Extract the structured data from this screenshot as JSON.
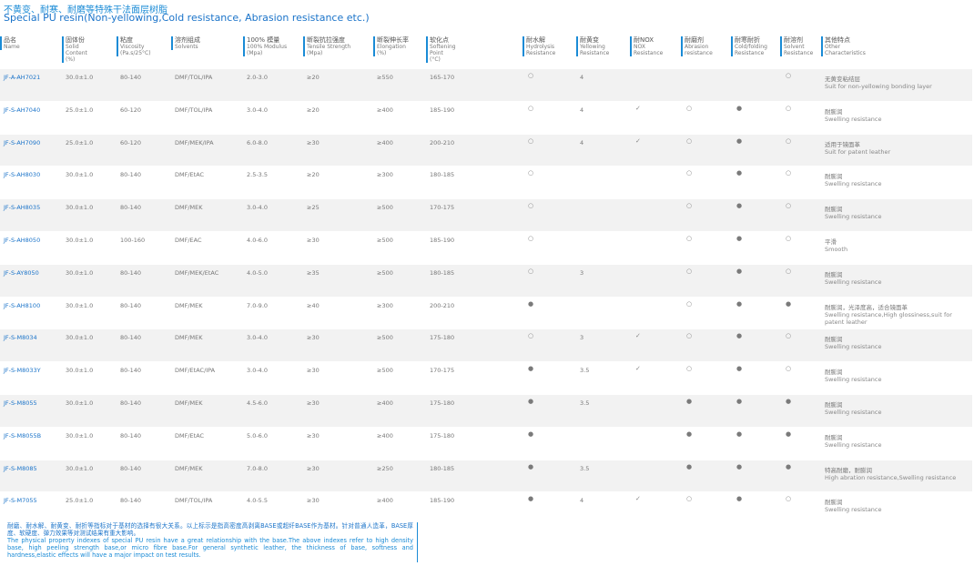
{
  "title": {
    "cn": "不黄变、耐寒、耐磨等特殊干法面层树脂",
    "en": "Special PU resin(Non-yellowing,Cold resistance, Abrasion resistance etc.)"
  },
  "headers": [
    {
      "cn": "品名",
      "en": [
        "Name"
      ]
    },
    {
      "cn": "固体份",
      "en": [
        "Solid",
        "Content",
        "(%)"
      ]
    },
    {
      "cn": "粘度",
      "en": [
        "Viscosity",
        "(Pa.s/25°C)"
      ]
    },
    {
      "cn": "溶剂组成",
      "en": [
        "Solvents"
      ]
    },
    {
      "cn": "100% 模量",
      "en": [
        "100% Modulus",
        "(Mpa)"
      ]
    },
    {
      "cn": "断裂抗拉强度",
      "en": [
        "Tensile Strength",
        "(Mpa)"
      ]
    },
    {
      "cn": "断裂伸长率",
      "en": [
        "Elongation",
        "(%)"
      ]
    },
    {
      "cn": "软化点",
      "en": [
        "Softening",
        "Point",
        "(°C)"
      ]
    },
    {
      "cn": "耐水解",
      "en": [
        "Hydrolysis",
        "Resistance"
      ]
    },
    {
      "cn": "耐黄变",
      "en": [
        "Yellowing",
        "Resistance"
      ]
    },
    {
      "cn": "耐NOX",
      "en": [
        "NOX",
        "Resistance"
      ]
    },
    {
      "cn": "耐磨剂",
      "en": [
        "Abrasion",
        "resistance"
      ]
    },
    {
      "cn": "耐寒耐折",
      "en": [
        "Cold/folding",
        "Resistance"
      ]
    },
    {
      "cn": "耐溶剂",
      "en": [
        "Solvent",
        "Resistance"
      ]
    },
    {
      "cn": "其他特点",
      "en": [
        "Other",
        "Characteristics"
      ]
    }
  ],
  "symbols": {
    "open": "○",
    "filled": "●",
    "check": "✓"
  },
  "rows": [
    {
      "name": "JF-A-AH7021",
      "solid": "30.0±1.0",
      "visc": "80-140",
      "solv": "DMF/TOL/IPA",
      "mod": "2.0-3.0",
      "ts": "≥20",
      "el": "≥550",
      "sp": "165-170",
      "hyd": "open",
      "yel": "4",
      "nox": "",
      "abr": "",
      "cold": "",
      "solvr": "open",
      "other_cn": "无黄变粘结层",
      "other_en": "Suit for non-yellowing bonding layer"
    },
    {
      "name": "JF-S-AH7040",
      "solid": "25.0±1.0",
      "visc": "60-120",
      "solv": "DMF/TOL/IPA",
      "mod": "3.0-4.0",
      "ts": "≥20",
      "el": "≥400",
      "sp": "185-190",
      "hyd": "open",
      "yel": "4",
      "nox": "check",
      "abr": "open",
      "cold": "filled",
      "solvr": "open",
      "other_cn": "耐膨润",
      "other_en": "Swelling resistance"
    },
    {
      "name": "JF-S-AH7090",
      "solid": "25.0±1.0",
      "visc": "60-120",
      "solv": "DMF/MEK/IPA",
      "mod": "6.0-8.0",
      "ts": "≥30",
      "el": "≥400",
      "sp": "200-210",
      "hyd": "open",
      "yel": "4",
      "nox": "check",
      "abr": "open",
      "cold": "filled",
      "solvr": "open",
      "other_cn": "适用于镜面革",
      "other_en": "Suit for patent leather"
    },
    {
      "name": "JF-S-AH8030",
      "solid": "30.0±1.0",
      "visc": "80-140",
      "solv": "DMF/EtAC",
      "mod": "2.5-3.5",
      "ts": "≥20",
      "el": "≥300",
      "sp": "180-185",
      "hyd": "open",
      "yel": "",
      "nox": "",
      "abr": "open",
      "cold": "filled",
      "solvr": "open",
      "other_cn": "耐膨润",
      "other_en": "Swelling resistance"
    },
    {
      "name": "JF-S-AH8035",
      "solid": "30.0±1.0",
      "visc": "80-140",
      "solv": "DMF/MEK",
      "mod": "3.0-4.0",
      "ts": "≥25",
      "el": "≥500",
      "sp": "170-175",
      "hyd": "open",
      "yel": "",
      "nox": "",
      "abr": "open",
      "cold": "filled",
      "solvr": "open",
      "other_cn": "耐膨润",
      "other_en": "Swelling resistance"
    },
    {
      "name": "JF-S-AH8050",
      "solid": "30.0±1.0",
      "visc": "100-160",
      "solv": "DMF/EAC",
      "mod": "4.0-6.0",
      "ts": "≥30",
      "el": "≥500",
      "sp": "185-190",
      "hyd": "open",
      "yel": "",
      "nox": "",
      "abr": "open",
      "cold": "filled",
      "solvr": "open",
      "other_cn": "平滑",
      "other_en": "Smooth"
    },
    {
      "name": "JF-S-AY8050",
      "solid": "30.0±1.0",
      "visc": "80-140",
      "solv": "DMF/MEK/EtAC",
      "mod": "4.0-5.0",
      "ts": "≥35",
      "el": "≥500",
      "sp": "180-185",
      "hyd": "open",
      "yel": "3",
      "nox": "",
      "abr": "open",
      "cold": "filled",
      "solvr": "open",
      "other_cn": "耐膨润",
      "other_en": "Swelling resistance"
    },
    {
      "name": "JF-S-AH8100",
      "solid": "30.0±1.0",
      "visc": "80-140",
      "solv": "DMF/MEK",
      "mod": "7.0-9.0",
      "ts": "≥40",
      "el": "≥300",
      "sp": "200-210",
      "hyd": "filled",
      "yel": "",
      "nox": "",
      "abr": "open",
      "cold": "filled",
      "solvr": "filled",
      "other_cn": "耐膨润，光泽度高，适合镜面革",
      "other_en": "Swelling resistance,High glossiness,suit for patent leather"
    },
    {
      "name": "JF-S-M8034",
      "solid": "30.0±1.0",
      "visc": "80-140",
      "solv": "DMF/MEK",
      "mod": "3.0-4.0",
      "ts": "≥30",
      "el": "≥500",
      "sp": "175-180",
      "hyd": "open",
      "yel": "3",
      "nox": "check",
      "abr": "open",
      "cold": "filled",
      "solvr": "open",
      "other_cn": "耐膨润",
      "other_en": "Swelling resistance"
    },
    {
      "name": "JF-S-M8033Y",
      "solid": "30.0±1.0",
      "visc": "80-140",
      "solv": "DMF/EtAC/IPA",
      "mod": "3.0-4.0",
      "ts": "≥30",
      "el": "≥500",
      "sp": "170-175",
      "hyd": "filled",
      "yel": "3.5",
      "nox": "check",
      "abr": "open",
      "cold": "filled",
      "solvr": "open",
      "other_cn": "耐膨润",
      "other_en": "Swelling resistance"
    },
    {
      "name": "JF-S-M8055",
      "solid": "30.0±1.0",
      "visc": "80-140",
      "solv": "DMF/MEK",
      "mod": "4.5-6.0",
      "ts": "≥30",
      "el": "≥400",
      "sp": "175-180",
      "hyd": "filled",
      "yel": "3.5",
      "nox": "",
      "abr": "filled",
      "cold": "filled",
      "solvr": "filled",
      "other_cn": "耐膨润",
      "other_en": "Swelling resistance"
    },
    {
      "name": "JF-S-M8055B",
      "solid": "30.0±1.0",
      "visc": "80-140",
      "solv": "DMF/EtAC",
      "mod": "5.0-6.0",
      "ts": "≥30",
      "el": "≥400",
      "sp": "175-180",
      "hyd": "filled",
      "yel": "",
      "nox": "",
      "abr": "filled",
      "cold": "filled",
      "solvr": "filled",
      "other_cn": "耐膨润",
      "other_en": "Swelling resistance"
    },
    {
      "name": "JF-S-M8085",
      "solid": "30.0±1.0",
      "visc": "80-140",
      "solv": "DMF/MEK",
      "mod": "7.0-8.0",
      "ts": "≥30",
      "el": "≥250",
      "sp": "180-185",
      "hyd": "filled",
      "yel": "3.5",
      "nox": "",
      "abr": "filled",
      "cold": "filled",
      "solvr": "filled",
      "other_cn": "特高耐磨，耐膨润",
      "other_en": "High abration resistance,Swelling resistance"
    },
    {
      "name": "JF-S-M7055",
      "solid": "25.0±1.0",
      "visc": "80-140",
      "solv": "DMF/TOL/IPA",
      "mod": "4.0-5.5",
      "ts": "≥30",
      "el": "≥400",
      "sp": "185-190",
      "hyd": "filled",
      "yel": "4",
      "nox": "check",
      "abr": "open",
      "cold": "filled",
      "solvr": "open",
      "other_cn": "耐膨润",
      "other_en": "Swelling resistance"
    }
  ],
  "note": {
    "cn": "耐磨、耐水解、耐黄变、耐折等指标对于基材的选择有很大关系。以上标示是指高密度高剥离BASE或超纤BASE作为基材。针对普通人造革，BASE厚度、软硬度、弹力效果等对测试结果有重大影响。",
    "en": "The physical property indexes of special PU resin have a great relationship with the base.The above indexes refer to high density base, high peeling strength base,or micro fibre base.For general synthetic leather, the thickness of base, softness and hardness,elastic effects will have a major impact on test results."
  }
}
